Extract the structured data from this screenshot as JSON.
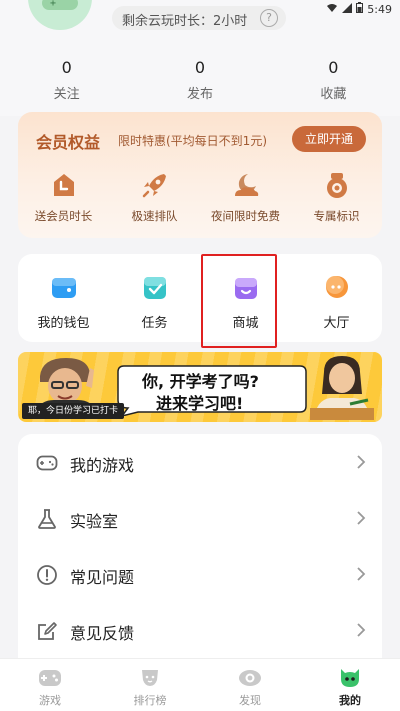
{
  "header": {
    "remaining_label": "剩余云玩时长：",
    "remaining_value": "2小时",
    "status_time": "5:49"
  },
  "stats": [
    {
      "num": "0",
      "label": "关注"
    },
    {
      "num": "0",
      "label": "发布"
    },
    {
      "num": "0",
      "label": "收藏"
    }
  ],
  "member": {
    "title": "会员权益",
    "subtitle": "限时特惠(平均每日不到1元)",
    "open_button": "立即开通",
    "perks": [
      {
        "label": "送会员时长",
        "icon": "clock-icon"
      },
      {
        "label": "极速排队",
        "icon": "rocket-icon"
      },
      {
        "label": "夜间限时免费",
        "icon": "cloud-moon-icon"
      },
      {
        "label": "专属标识",
        "icon": "badge-icon"
      }
    ]
  },
  "quick": [
    {
      "label": "我的钱包",
      "icon": "wallet-icon",
      "color": "#2e9df3"
    },
    {
      "label": "任务",
      "icon": "task-icon",
      "color": "#35c3c7"
    },
    {
      "label": "商城",
      "icon": "store-icon",
      "color": "#9a6bf0"
    },
    {
      "label": "大厅",
      "icon": "chat-icon",
      "color": "#f7963a"
    }
  ],
  "banner": {
    "line1": "你, 开学考了吗?",
    "line2": "进来学习吧!",
    "ticker": "耶，今日份学习已打卡"
  },
  "menu": [
    {
      "label": "我的游戏",
      "icon": "gamepad-icon"
    },
    {
      "label": "实验室",
      "icon": "flask-icon"
    },
    {
      "label": "常见问题",
      "icon": "question-icon"
    },
    {
      "label": "意见反馈",
      "icon": "feedback-icon"
    }
  ],
  "tabs": [
    {
      "label": "游戏",
      "icon": "gamepad-tab-icon"
    },
    {
      "label": "排行榜",
      "icon": "trophy-icon"
    },
    {
      "label": "发现",
      "icon": "eye-icon"
    },
    {
      "label": "我的",
      "icon": "profile-icon",
      "active": true
    }
  ],
  "colors": {
    "accent": "#c9693a",
    "highlight": "#e02020",
    "banner": "#fdc93a"
  }
}
